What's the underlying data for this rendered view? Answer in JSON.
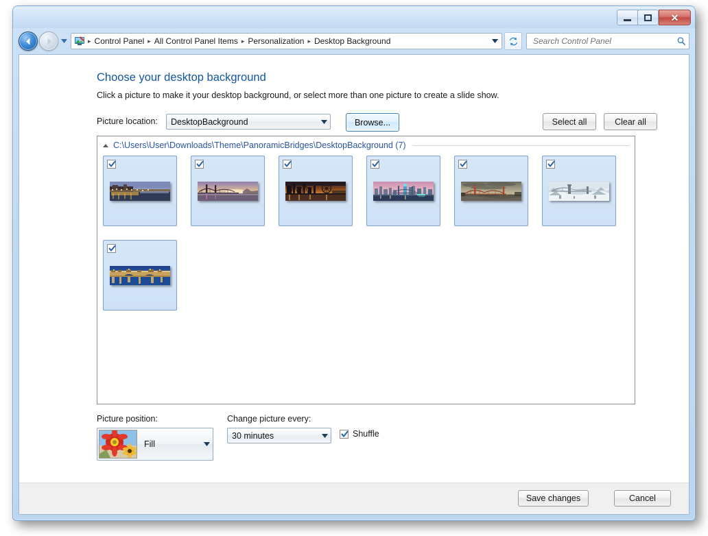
{
  "window": {
    "caption_buttons": {
      "minimize": "Minimize",
      "maximize": "Maximize",
      "close": "Close",
      "close_glyph": "✕"
    }
  },
  "navbar": {
    "back_tooltip": "Back",
    "forward_tooltip": "Forward",
    "history_tooltip": "Recent pages",
    "refresh_tooltip": "Refresh",
    "breadcrumbs": [
      "Control Panel",
      "All Control Panel Items",
      "Personalization",
      "Desktop Background"
    ],
    "separator": "▸",
    "search": {
      "placeholder": "Search Control Panel",
      "value": ""
    }
  },
  "page": {
    "title": "Choose your desktop background",
    "subtitle": "Click a picture to make it your desktop background, or select more than one picture to create a slide show."
  },
  "location": {
    "label": "Picture location:",
    "selected": "DesktopBackground",
    "browse_label": "Browse...",
    "select_all_label": "Select all",
    "clear_all_label": "Clear all"
  },
  "group": {
    "header": "C:\\Users\\User\\Downloads\\Theme\\PanoramicBridges\\DesktopBackground (7)",
    "expanded": true,
    "count": 7
  },
  "thumbnails": [
    {
      "name": "bridge-florence-night",
      "checked": true,
      "scene": "night-city-bridge-river"
    },
    {
      "name": "bridge-suspension-sunset",
      "checked": true,
      "scene": "sunset-suspension-bridge"
    },
    {
      "name": "bridge-cablestay-dusk",
      "checked": true,
      "scene": "dusk-cable-stay-ferris-wheel"
    },
    {
      "name": "bridge-rainbow-tokyo",
      "checked": true,
      "scene": "pink-sky-bay-city-bridge"
    },
    {
      "name": "bridge-golden-gate",
      "checked": true,
      "scene": "golden-gate-stormy-sky"
    },
    {
      "name": "bridge-winter-gorge",
      "checked": true,
      "scene": "snowy-gorge-suspension-bridge"
    },
    {
      "name": "bridge-stone-arch-night",
      "checked": true,
      "scene": "illuminated-stone-arch-bridge"
    }
  ],
  "options": {
    "position_label": "Picture position:",
    "position_value": "Fill",
    "change_label": "Change picture every:",
    "change_value": "30 minutes",
    "shuffle_label": "Shuffle",
    "shuffle_checked": true
  },
  "footer": {
    "save_label": "Save changes",
    "cancel_label": "Cancel"
  },
  "colors": {
    "title_text": "#13559e",
    "link_blue": "#2a55a0",
    "tile_selected_bg": "#d6e6f8",
    "tile_border": "#7ba3cd",
    "frame_blue": "#bdd6f0",
    "footer_bg": "#f0f0f0",
    "close_red": "#bf4a43"
  }
}
